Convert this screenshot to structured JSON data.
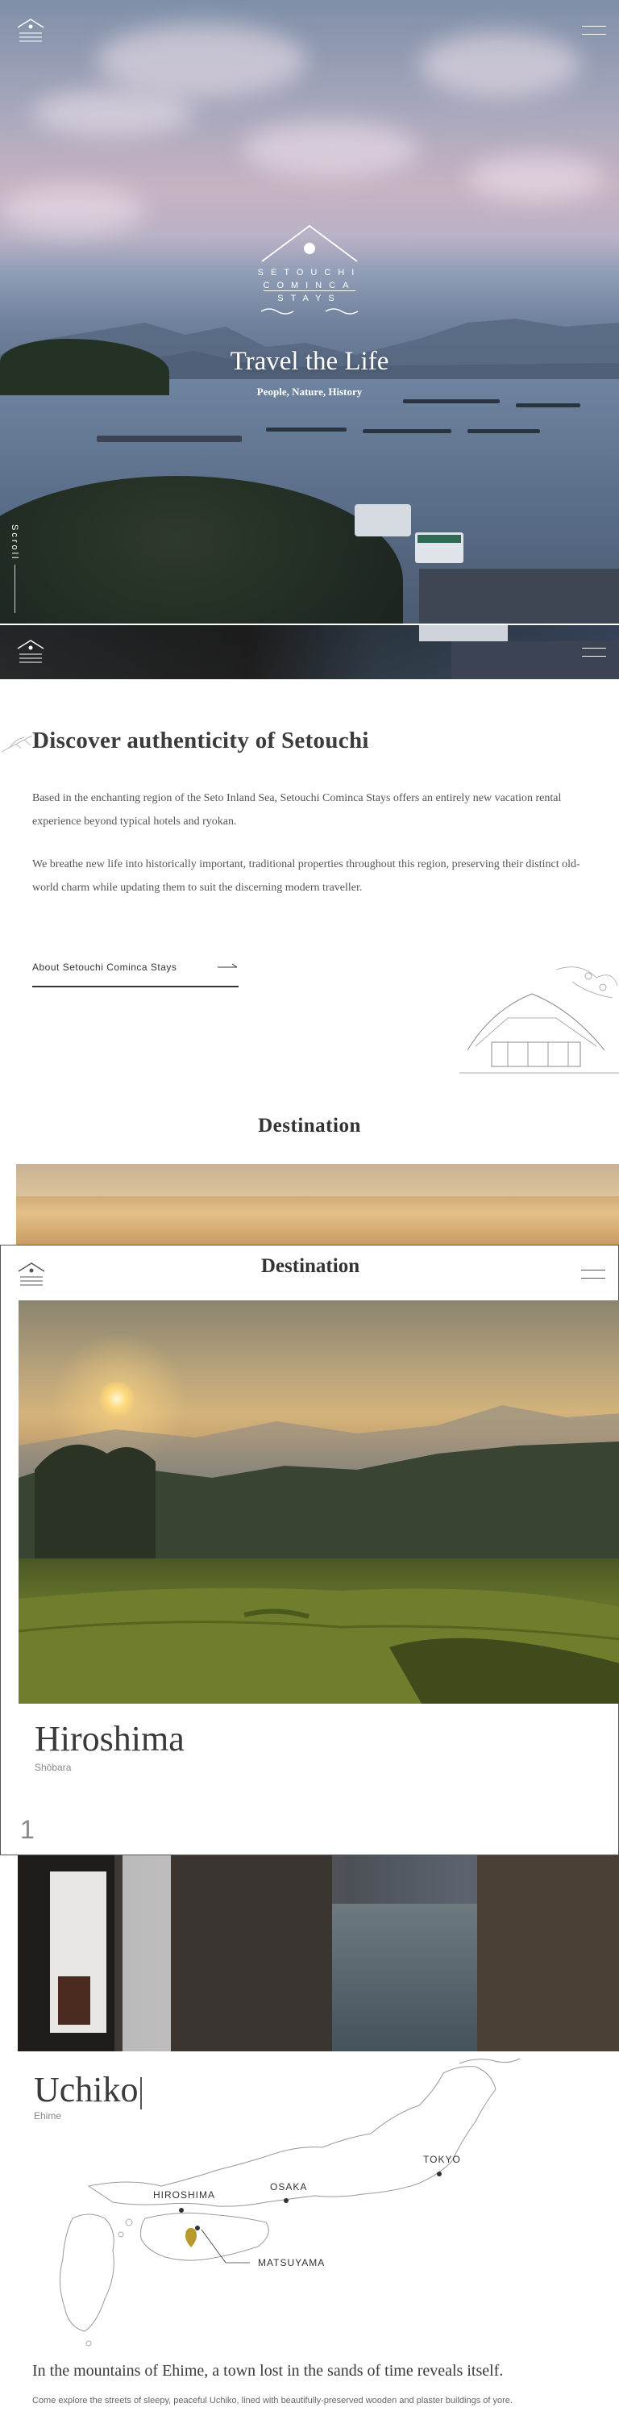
{
  "brand": {
    "lines": [
      "SETOUCHI",
      "COMINCA",
      "STAYS"
    ]
  },
  "hero": {
    "title": "Travel the Life",
    "subtitle": "People, Nature, History",
    "scroll_label": "Scroll"
  },
  "about": {
    "title": "Discover authenticity of Setouchi",
    "paragraph_1": "Based in the enchanting region of the Seto Inland Sea, Setouchi Cominca Stays offers an entirely new vacation rental experience beyond typical hotels and ryokan.",
    "paragraph_2": "We breathe new life into historically important, traditional properties throughout this region, preserving their distinct old-world charm while updating them to suit the discerning modern traveller.",
    "link_label": "About Setouchi Cominca Stays"
  },
  "destination": {
    "section_title": "Destination",
    "header_title": "Destination",
    "items": [
      {
        "name": "Hiroshima",
        "area": "Shōbara",
        "index": "1"
      },
      {
        "name": "Uchiko",
        "area": "Ehime"
      }
    ],
    "map_labels": {
      "hiroshima": "HIROSHIMA",
      "osaka": "OSAKA",
      "tokyo": "TOKYO",
      "matsuyama": "MATSUYAMA"
    },
    "uchiko_lead": "In the mountains of Ehime, a town lost in the sands of time reveals itself.",
    "uchiko_desc": "Come explore the streets of sleepy, peaceful Uchiko, lined with beautifully-preserved wooden and plaster buildings of yore."
  },
  "colors": {
    "accent_gold": "#b79a2b",
    "text_dark": "#3a3a3a"
  }
}
